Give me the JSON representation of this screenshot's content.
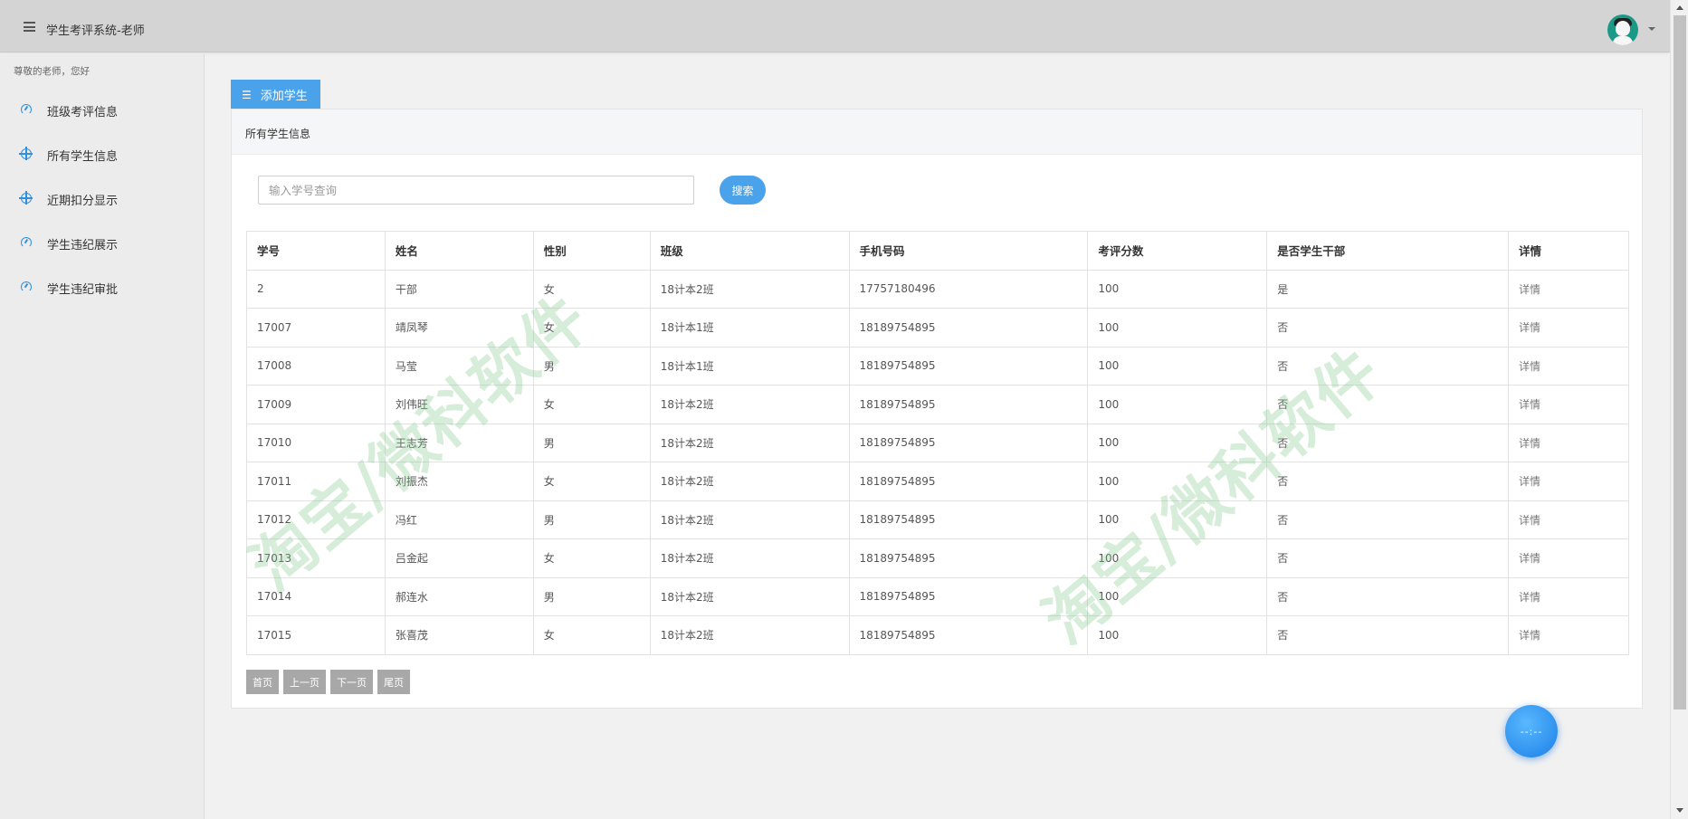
{
  "app": {
    "title": "学生考评系统-老师"
  },
  "sidebar": {
    "greeting": "尊敬的老师，您好",
    "items": [
      {
        "label": "班级考评信息",
        "icon": "gauge-icon"
      },
      {
        "label": "所有学生信息",
        "icon": "crosshair-icon"
      },
      {
        "label": "近期扣分显示",
        "icon": "crosshair-icon"
      },
      {
        "label": "学生违纪展示",
        "icon": "gauge-icon"
      },
      {
        "label": "学生违纪审批",
        "icon": "gauge-icon"
      }
    ]
  },
  "main": {
    "tab_label": "添加学生",
    "panel_title": "所有学生信息",
    "search": {
      "placeholder": "输入学号查询",
      "value": "",
      "button_label": "搜索"
    },
    "table": {
      "columns": [
        "学号",
        "姓名",
        "性别",
        "班级",
        "手机号码",
        "考评分数",
        "是否学生干部",
        "详情"
      ],
      "rows": [
        [
          "2",
          "干部",
          "女",
          "18计本2班",
          "17757180496",
          "100",
          "是",
          "详情"
        ],
        [
          "17007",
          "靖凤琴",
          "女",
          "18计本1班",
          "18189754895",
          "100",
          "否",
          "详情"
        ],
        [
          "17008",
          "马莹",
          "男",
          "18计本1班",
          "18189754895",
          "100",
          "否",
          "详情"
        ],
        [
          "17009",
          "刘伟旺",
          "女",
          "18计本2班",
          "18189754895",
          "100",
          "否",
          "详情"
        ],
        [
          "17010",
          "王志芳",
          "男",
          "18计本2班",
          "18189754895",
          "100",
          "否",
          "详情"
        ],
        [
          "17011",
          "刘振杰",
          "女",
          "18计本2班",
          "18189754895",
          "100",
          "否",
          "详情"
        ],
        [
          "17012",
          "冯红",
          "男",
          "18计本2班",
          "18189754895",
          "100",
          "否",
          "详情"
        ],
        [
          "17013",
          "吕金起",
          "女",
          "18计本2班",
          "18189754895",
          "100",
          "否",
          "详情"
        ],
        [
          "17014",
          "郝连水",
          "男",
          "18计本2班",
          "18189754895",
          "100",
          "否",
          "详情"
        ],
        [
          "17015",
          "张喜茂",
          "女",
          "18计本2班",
          "18189754895",
          "100",
          "否",
          "详情"
        ]
      ]
    },
    "pager": {
      "first": "首页",
      "prev": "上一页",
      "next": "下一页",
      "last": "尾页"
    }
  },
  "watermark": {
    "text": "淘宝/微科软件"
  },
  "float_button": {
    "label": "--:--"
  },
  "colors": {
    "accent": "#4aa2ea",
    "topbar": "#d4d4d4",
    "pager": "#a8a8a8",
    "watermark": "#82c88c"
  }
}
